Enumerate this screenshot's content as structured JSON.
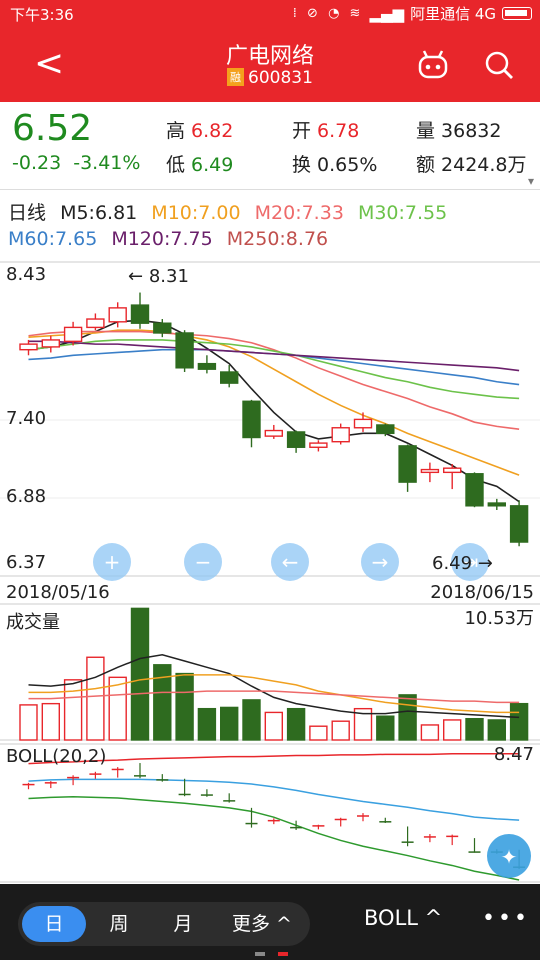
{
  "status_bar": {
    "time": "下午3:36",
    "carrier": "阿里通信 4G"
  },
  "header": {
    "title": "广电网络",
    "code": "600831",
    "tag": "融"
  },
  "quote": {
    "price": "6.52",
    "change": "-0.23",
    "change_pct": "-3.41%",
    "high_label": "高",
    "high": "6.82",
    "low_label": "低",
    "low": "6.49",
    "open_label": "开",
    "open": "6.78",
    "turnover_label": "换",
    "turnover": "0.65%",
    "volume_label": "量",
    "volume": "36832",
    "amount_label": "额",
    "amount": "2424.8万"
  },
  "ma_legend": {
    "period": "日线",
    "m5": "M5:6.81",
    "m10": "M10:7.00",
    "m20": "M20:7.33",
    "m30": "M30:7.55",
    "m60": "M60:7.65",
    "m120": "M120:7.75",
    "m250": "M250:8.76"
  },
  "colors": {
    "up": "#e8262b",
    "down": "#2e6b1f",
    "m5": "#222222",
    "m10": "#f0a020",
    "m20": "#ee6a6a",
    "m30": "#6cc24a",
    "m60": "#3a7fc8",
    "m120": "#6a1f6a",
    "m250": "#c0504d"
  },
  "kline": {
    "y_ticks": [
      "8.43",
      "7.40",
      "6.88",
      "6.37"
    ],
    "date_start": "2018/05/16",
    "date_end": "2018/06/15",
    "max_label": "8.31",
    "min_label": "6.49",
    "candles": [
      {
        "o": 7.9,
        "c": 7.94,
        "h": 7.97,
        "l": 7.86
      },
      {
        "o": 7.92,
        "c": 7.97,
        "h": 8.0,
        "l": 7.88
      },
      {
        "o": 7.96,
        "c": 8.06,
        "h": 8.1,
        "l": 7.93
      },
      {
        "o": 8.06,
        "c": 8.12,
        "h": 8.16,
        "l": 8.04
      },
      {
        "o": 8.1,
        "c": 8.2,
        "h": 8.24,
        "l": 8.06
      },
      {
        "o": 8.22,
        "c": 8.09,
        "h": 8.31,
        "l": 8.05
      },
      {
        "o": 8.09,
        "c": 8.02,
        "h": 8.12,
        "l": 7.99
      },
      {
        "o": 8.02,
        "c": 7.77,
        "h": 8.04,
        "l": 7.74
      },
      {
        "o": 7.8,
        "c": 7.76,
        "h": 7.86,
        "l": 7.73
      },
      {
        "o": 7.74,
        "c": 7.66,
        "h": 7.79,
        "l": 7.63
      },
      {
        "o": 7.53,
        "c": 7.27,
        "h": 7.54,
        "l": 7.2
      },
      {
        "o": 7.28,
        "c": 7.32,
        "h": 7.36,
        "l": 7.26
      },
      {
        "o": 7.31,
        "c": 7.2,
        "h": 7.32,
        "l": 7.16
      },
      {
        "o": 7.2,
        "c": 7.23,
        "h": 7.25,
        "l": 7.17
      },
      {
        "o": 7.24,
        "c": 7.34,
        "h": 7.37,
        "l": 7.22
      },
      {
        "o": 7.34,
        "c": 7.4,
        "h": 7.45,
        "l": 7.31
      },
      {
        "o": 7.36,
        "c": 7.3,
        "h": 7.37,
        "l": 7.28
      },
      {
        "o": 7.21,
        "c": 6.95,
        "h": 7.22,
        "l": 6.88
      },
      {
        "o": 7.02,
        "c": 7.04,
        "h": 7.09,
        "l": 6.95
      },
      {
        "o": 7.02,
        "c": 7.05,
        "h": 7.08,
        "l": 6.9
      },
      {
        "o": 7.01,
        "c": 6.78,
        "h": 7.02,
        "l": 6.77
      },
      {
        "o": 6.8,
        "c": 6.78,
        "h": 6.83,
        "l": 6.75
      },
      {
        "o": 6.78,
        "c": 6.52,
        "h": 6.82,
        "l": 6.49
      }
    ],
    "ma": {
      "m5": [
        7.9,
        7.92,
        7.96,
        8.03,
        8.1,
        8.11,
        8.09,
        8.01,
        7.91,
        7.8,
        7.62,
        7.45,
        7.31,
        7.26,
        7.28,
        7.3,
        7.3,
        7.23,
        7.15,
        7.07,
        6.97,
        6.92,
        6.81
      ],
      "m10": [
        7.99,
        8.0,
        8.01,
        8.02,
        8.04,
        8.04,
        8.03,
        8.0,
        7.97,
        7.92,
        7.85,
        7.76,
        7.67,
        7.58,
        7.5,
        7.43,
        7.37,
        7.3,
        7.24,
        7.18,
        7.12,
        7.06,
        7.0
      ],
      "m20": [
        8.0,
        8.02,
        8.03,
        8.03,
        8.03,
        8.03,
        8.02,
        8.01,
        8.0,
        7.98,
        7.95,
        7.9,
        7.84,
        7.77,
        7.71,
        7.65,
        7.6,
        7.55,
        7.49,
        7.44,
        7.38,
        7.35,
        7.33
      ],
      "m30": [
        7.9,
        7.92,
        7.94,
        7.96,
        7.97,
        7.97,
        7.97,
        7.96,
        7.95,
        7.94,
        7.92,
        7.89,
        7.86,
        7.82,
        7.78,
        7.74,
        7.7,
        7.67,
        7.63,
        7.6,
        7.58,
        7.56,
        7.55
      ],
      "m60": [
        7.83,
        7.84,
        7.86,
        7.87,
        7.88,
        7.89,
        7.9,
        7.9,
        7.9,
        7.89,
        7.88,
        7.87,
        7.86,
        7.84,
        7.82,
        7.8,
        7.78,
        7.76,
        7.74,
        7.72,
        7.7,
        7.67,
        7.65
      ],
      "m120": [
        7.96,
        7.96,
        7.95,
        7.94,
        7.94,
        7.93,
        7.92,
        7.91,
        7.9,
        7.89,
        7.88,
        7.87,
        7.86,
        7.85,
        7.84,
        7.83,
        7.82,
        7.81,
        7.8,
        7.79,
        7.78,
        7.77,
        7.75
      ]
    }
  },
  "volume": {
    "title": "成交量",
    "max_label": "10.53万",
    "values": [
      2.8,
      2.9,
      4.8,
      6.6,
      5.0,
      10.5,
      6.0,
      5.3,
      2.5,
      2.6,
      3.2,
      2.2,
      2.5,
      1.1,
      1.5,
      2.5,
      1.9,
      3.6,
      1.2,
      1.6,
      1.7,
      1.6,
      2.9
    ],
    "ma5": [
      4.4,
      4.3,
      4.5,
      5.0,
      5.8,
      6.5,
      6.8,
      6.3,
      5.8,
      5.3,
      4.3,
      3.4,
      2.9,
      2.6,
      2.3,
      2.1,
      2.1,
      2.3,
      2.2,
      2.1,
      2.0,
      1.9,
      1.8
    ],
    "ma10": [
      3.8,
      3.8,
      3.9,
      4.1,
      4.4,
      4.8,
      5.0,
      5.2,
      5.2,
      5.2,
      5.0,
      4.7,
      4.4,
      3.9,
      3.6,
      3.3,
      3.0,
      2.8,
      2.6,
      2.4,
      2.3,
      2.2,
      2.2
    ],
    "ma20": [
      3.3,
      3.3,
      3.4,
      3.5,
      3.6,
      3.7,
      3.8,
      3.8,
      3.9,
      3.9,
      3.9,
      3.9,
      3.8,
      3.7,
      3.6,
      3.5,
      3.4,
      3.3,
      3.2,
      3.1,
      3.1,
      3.0,
      3.0
    ]
  },
  "boll": {
    "title": "BOLL(20,2)",
    "max_label": "8.47",
    "upper": [
      8.3,
      8.32,
      8.33,
      8.35,
      8.36,
      8.38,
      8.39,
      8.4,
      8.41,
      8.42,
      8.42,
      8.43,
      8.44,
      8.44,
      8.45,
      8.45,
      8.46,
      8.46,
      8.46,
      8.47,
      8.47,
      8.47,
      8.47
    ],
    "mid": [
      8.0,
      8.02,
      8.03,
      8.03,
      8.03,
      8.03,
      8.02,
      8.01,
      8.0,
      7.98,
      7.95,
      7.9,
      7.84,
      7.77,
      7.71,
      7.65,
      7.6,
      7.55,
      7.49,
      7.44,
      7.38,
      7.35,
      7.33
    ],
    "lower": [
      7.7,
      7.72,
      7.73,
      7.72,
      7.71,
      7.68,
      7.65,
      7.62,
      7.58,
      7.54,
      7.48,
      7.38,
      7.24,
      7.1,
      6.98,
      6.88,
      6.8,
      6.72,
      6.63,
      6.55,
      6.45,
      6.38,
      6.3
    ]
  },
  "bottom_bar": {
    "tabs": [
      "日",
      "周",
      "月",
      "更多 ^"
    ],
    "indicator": "BOLL ^",
    "more": "•••"
  }
}
